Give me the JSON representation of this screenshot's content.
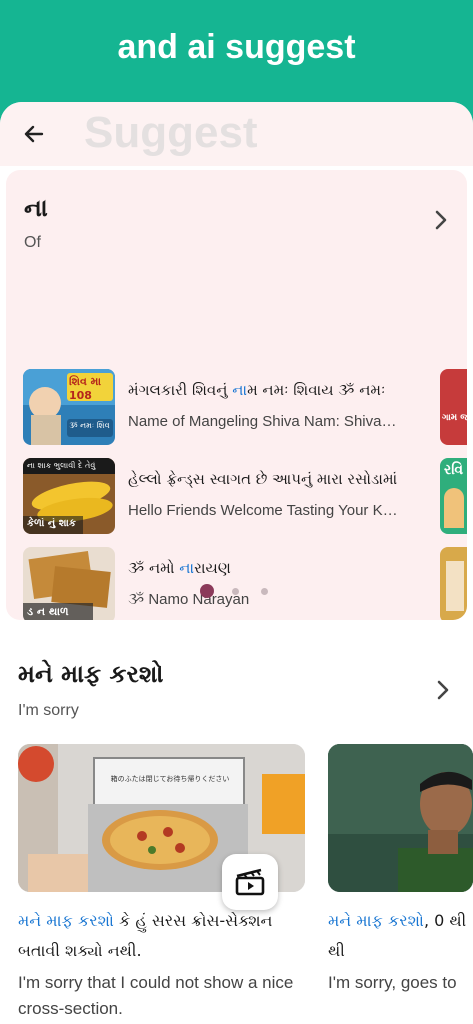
{
  "banner": {
    "title": "and ai suggest"
  },
  "header": {
    "title": "Suggest"
  },
  "card": {
    "title": "ના",
    "subtitle": "Of",
    "items": [
      {
        "title_pre": "મંગલકારી શિવનું ",
        "title_hl": "ના",
        "title_post": "મ નમઃ શિવાય ૐ નમઃ",
        "subtitle": "Name of Mangeling Shiva Nam: Shiva Om Namah",
        "thumb_text": "શિવ મા 108",
        "thumb_sub": "ૐ નમઃ શિવ"
      },
      {
        "title_pre": "હેલ્લો ફ્રેન્ડ્સ સ્વાગત છે આપનું મારા રસોડામાં",
        "title_hl": "",
        "title_post": "",
        "subtitle": "Hello Friends Welcome Tasting Your Kitchen",
        "thumb_text": "કેળાં નું શાક",
        "thumb_sub": "ના શાક ભુલાવી દે તેવું"
      },
      {
        "title_pre": "ૐ નમો ",
        "title_hl": "ના",
        "title_post": "રાયણ",
        "subtitle": "ૐ Namo Narayan",
        "thumb_text": "ડ ન થાળ",
        "thumb_sub": ""
      }
    ],
    "peek_texts": [
      "ગામ જ",
      "રવિ",
      ""
    ],
    "pager": {
      "total": 3,
      "active": 0
    }
  },
  "section": {
    "title": "મને માફ કરશો",
    "subtitle": "I'm sorry",
    "videos": [
      {
        "title_hl": "મને માફ કરશો",
        "title_rest": " કે હું સરસ ક્રોસ-સેક્શન બતાવી શક્યો નથી.",
        "subtitle": "I'm sorry that I could not show a nice cross-section.",
        "image_text": "箱のふたは閉じてお待ち帰りください"
      },
      {
        "title_hl": "મને માફ કરશો",
        "title_rest": ", 0 થી",
        "title_rest2": "થી",
        "subtitle": "I'm sorry, goes to"
      }
    ]
  },
  "colors": {
    "accent": "#15b592",
    "highlight": "#1976d2",
    "dot_active": "#8b3a5a",
    "dot_inactive": "#c9b9bd"
  }
}
